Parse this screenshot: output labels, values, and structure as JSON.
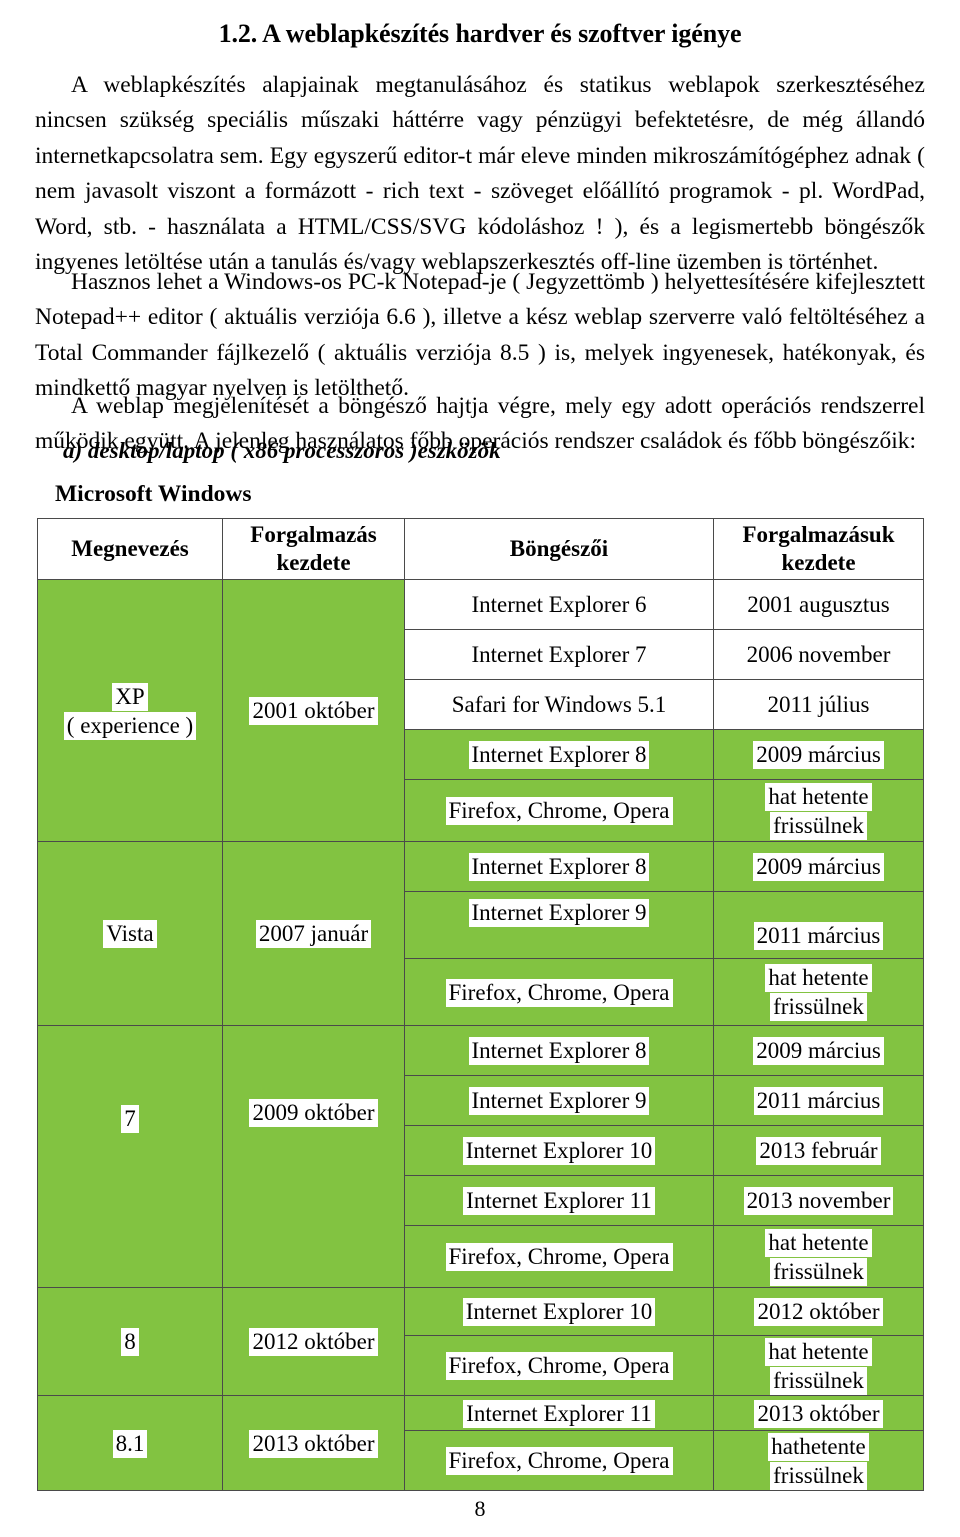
{
  "document": {
    "title": "1.2. A weblapkészítés hardver és szoftver igénye",
    "page_number": "8",
    "paragraphs": [
      "A weblapkészítés alapjainak megtanulásához és statikus weblapok szerkesztéséhez nincsen szükség speciális műszaki háttérre vagy pénzügyi befektetésre, de még állandó internetkapcsolatra sem. Egy egyszerű editor-t már eleve minden mikroszámítógéphez adnak ( nem javasolt viszont a formázott - rich text - szöveget előállító programok - pl. WordPad, Word, stb. - használata a HTML/CSS/SVG kódoláshoz ! ), és a legismertebb böngészők ingyenes letöltése után a tanulás és/vagy weblapszerkesztés off-line üzemben is történhet.",
      "Hasznos lehet a Windows-os PC-k Notepad-je ( Jegyzettömb ) helyettesítésére kifejlesztett Notepad++ editor ( aktuális verziója 6.6 ), illetve a kész weblap szerverre való feltöltéséhez a Total Commander fájlkezelő ( aktuális verziója 8.5 ) is, melyek ingyenesek, hatékonyak, és mindkettő magyar nyelven is letölthető.",
      "A weblap megjelenítését a böngésző hajtja végre, mely egy adott operációs rendszerrel működik együtt. A jelenleg használatos főbb operációs rendszer családok és főbb böngészőik:"
    ],
    "subheading_a": "a) desktop/laptop ( x86 processzoros )eszközök",
    "subheading_os": "Microsoft Windows"
  },
  "colors": {
    "table_fill_green": "#82c341",
    "table_border": "#4a4a4a",
    "highlight_white": "#ffffff",
    "text": "#000000"
  },
  "table": {
    "headers": [
      "Megnevezés",
      "Forgalmazás kezdete",
      "Böngészői",
      "Forgalmazásuk kezdete"
    ],
    "header_lines": {
      "c0": [
        "Megnevezés"
      ],
      "c1": [
        "Forgalmazás",
        "kezdete"
      ],
      "c2": [
        "Böngészői"
      ],
      "c3": [
        "Forgalmazásuk",
        "kezdete"
      ]
    },
    "rows": [
      {
        "browser": "Internet Explorer 6",
        "browser_start": "2001 augusztus",
        "shade": "white"
      },
      {
        "browser": "Internet Explorer 7",
        "browser_start": "2006 november",
        "shade": "white"
      },
      {
        "browser": "Safari for Windows 5.1",
        "browser_start": "2011 július",
        "shade": "white"
      },
      {
        "browser": "Internet Explorer 8",
        "browser_start": "2009 március",
        "shade": "green"
      },
      {
        "browser": "Firefox, Chrome, Opera",
        "browser_start_l1": "hat hetente",
        "browser_start_l2": "frissülnek",
        "shade": "green"
      },
      {
        "browser": "Internet Explorer 8",
        "browser_start": "2009 március",
        "shade": "green"
      },
      {
        "browser": "Internet Explorer 9",
        "browser_start": "2011 március",
        "shade": "green"
      },
      {
        "browser": "Firefox, Chrome, Opera",
        "browser_start_l1": "hat hetente",
        "browser_start_l2": "frissülnek",
        "shade": "green"
      },
      {
        "browser": "Internet Explorer 8",
        "browser_start": "2009 március",
        "shade": "green"
      },
      {
        "browser": "Internet Explorer 9",
        "browser_start": "2011 március",
        "shade": "green"
      },
      {
        "browser": "Internet Explorer 10",
        "browser_start": "2013 február",
        "shade": "green"
      },
      {
        "browser": "Internet Explorer 11",
        "browser_start": "2013 november",
        "shade": "green"
      },
      {
        "browser": "Firefox, Chrome, Opera",
        "browser_start_l1": "hat hetente",
        "browser_start_l2": "frissülnek",
        "shade": "green"
      },
      {
        "browser": "Internet Explorer 10",
        "browser_start": "2012 október",
        "shade": "green"
      },
      {
        "browser": "Firefox, Chrome, Opera",
        "browser_start_l1": "hat hetente",
        "browser_start_l2": "frissülnek",
        "shade": "green"
      },
      {
        "browser": "Internet Explorer 11",
        "browser_start": "2013 október",
        "shade": "green"
      },
      {
        "browser": "Firefox, Chrome, Opera",
        "browser_start_l1": "hathetente",
        "browser_start_l2": "frissülnek",
        "shade": "green"
      }
    ],
    "os_versions": [
      {
        "name_l1": "XP",
        "name_l2": "( experience )",
        "release": "2001 október",
        "rowspan": 5
      },
      {
        "name_l1": "Vista",
        "name_l2": "",
        "release": "2007 január",
        "rowspan": 3
      },
      {
        "name_l1": "7",
        "name_l2": "",
        "release": "2009 október",
        "rowspan": 5
      },
      {
        "name_l1": "8",
        "name_l2": "",
        "release": "2012 október",
        "rowspan": 2
      },
      {
        "name_l1": "8.1",
        "name_l2": "",
        "release": "2013 október",
        "rowspan": 2
      }
    ]
  }
}
